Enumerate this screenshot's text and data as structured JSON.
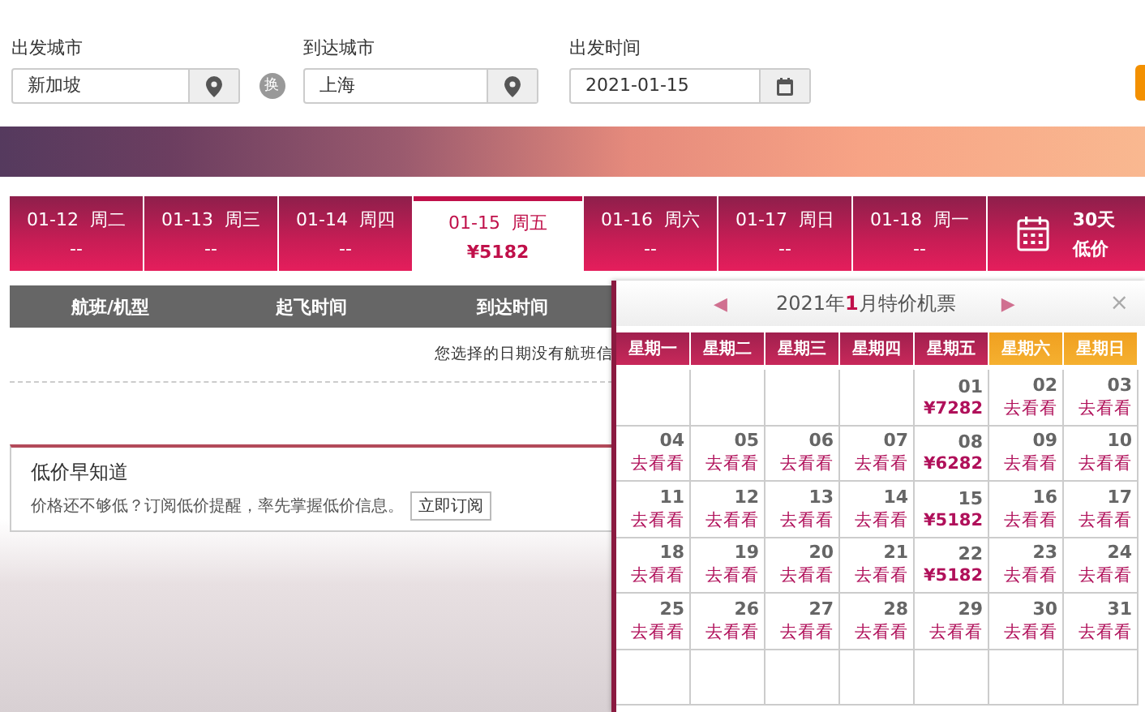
{
  "search": {
    "from": {
      "label": "出发城市",
      "value": "新加坡"
    },
    "swap": "换",
    "to": {
      "label": "到达城市",
      "value": "上海"
    },
    "date": {
      "label": "出发时间",
      "value": "2021-01-15"
    }
  },
  "date_tabs": [
    {
      "date": "01-12",
      "weekday": "周二",
      "price": "--",
      "selected": false
    },
    {
      "date": "01-13",
      "weekday": "周三",
      "price": "--",
      "selected": false
    },
    {
      "date": "01-14",
      "weekday": "周四",
      "price": "--",
      "selected": false
    },
    {
      "date": "01-15",
      "weekday": "周五",
      "price": "¥5182",
      "selected": true
    },
    {
      "date": "01-16",
      "weekday": "周六",
      "price": "--",
      "selected": false
    },
    {
      "date": "01-17",
      "weekday": "周日",
      "price": "--",
      "selected": false
    },
    {
      "date": "01-18",
      "weekday": "周一",
      "price": "--",
      "selected": false
    }
  ],
  "low_price_tab": {
    "line1": "30天",
    "line2": "低价"
  },
  "table": {
    "columns": [
      "航班/机型",
      "起飞时间",
      "到达时间"
    ],
    "message": "您选择的日期没有航班信"
  },
  "subscribe": {
    "title": "低价早知道",
    "text": "价格还不够低？订阅低价提醒，率先掌握低价信息。",
    "button": "立即订阅"
  },
  "calendar": {
    "prev": "◀",
    "title": "2021年**1**月特价机票",
    "next": "▶",
    "close": "×",
    "weekdays": [
      {
        "label": "星期一",
        "weekend": false
      },
      {
        "label": "星期二",
        "weekend": false
      },
      {
        "label": "星期三",
        "weekend": false
      },
      {
        "label": "星期四",
        "weekend": false
      },
      {
        "label": "星期五",
        "weekend": false
      },
      {
        "label": "星期六",
        "weekend": true
      },
      {
        "label": "星期日",
        "weekend": true
      }
    ],
    "weeks": [
      [
        {
          "kind": "empty"
        },
        {
          "kind": "empty"
        },
        {
          "kind": "empty"
        },
        {
          "kind": "empty"
        },
        {
          "kind": "price",
          "day": "01",
          "note": "¥7282"
        },
        {
          "kind": "link",
          "day": "02",
          "note": "去看看"
        },
        {
          "kind": "link",
          "day": "03",
          "note": "去看看"
        }
      ],
      [
        {
          "kind": "link",
          "day": "04",
          "note": "去看看"
        },
        {
          "kind": "link",
          "day": "05",
          "note": "去看看"
        },
        {
          "kind": "link",
          "day": "06",
          "note": "去看看"
        },
        {
          "kind": "link",
          "day": "07",
          "note": "去看看"
        },
        {
          "kind": "price",
          "day": "08",
          "note": "¥6282"
        },
        {
          "kind": "link",
          "day": "09",
          "note": "去看看"
        },
        {
          "kind": "link",
          "day": "10",
          "note": "去看看"
        }
      ],
      [
        {
          "kind": "link",
          "day": "11",
          "note": "去看看"
        },
        {
          "kind": "link",
          "day": "12",
          "note": "去看看"
        },
        {
          "kind": "link",
          "day": "13",
          "note": "去看看"
        },
        {
          "kind": "link",
          "day": "14",
          "note": "去看看"
        },
        {
          "kind": "price",
          "day": "15",
          "note": "¥5182"
        },
        {
          "kind": "link",
          "day": "16",
          "note": "去看看"
        },
        {
          "kind": "link",
          "day": "17",
          "note": "去看看"
        }
      ],
      [
        {
          "kind": "link",
          "day": "18",
          "note": "去看看"
        },
        {
          "kind": "link",
          "day": "19",
          "note": "去看看"
        },
        {
          "kind": "link",
          "day": "20",
          "note": "去看看"
        },
        {
          "kind": "link",
          "day": "21",
          "note": "去看看"
        },
        {
          "kind": "price",
          "day": "22",
          "note": "¥5182"
        },
        {
          "kind": "link",
          "day": "23",
          "note": "去看看"
        },
        {
          "kind": "link",
          "day": "24",
          "note": "去看看"
        }
      ],
      [
        {
          "kind": "link",
          "day": "25",
          "note": "去看看"
        },
        {
          "kind": "link",
          "day": "26",
          "note": "去看看"
        },
        {
          "kind": "link",
          "day": "27",
          "note": "去看看"
        },
        {
          "kind": "link",
          "day": "28",
          "note": "去看看"
        },
        {
          "kind": "link",
          "day": "29",
          "note": "去看看"
        },
        {
          "kind": "link",
          "day": "30",
          "note": "去看看"
        },
        {
          "kind": "link",
          "day": "31",
          "note": "去看看"
        }
      ],
      [
        {
          "kind": "empty"
        },
        {
          "kind": "empty"
        },
        {
          "kind": "empty"
        },
        {
          "kind": "empty"
        },
        {
          "kind": "empty"
        },
        {
          "kind": "empty"
        },
        {
          "kind": "empty"
        }
      ]
    ]
  }
}
